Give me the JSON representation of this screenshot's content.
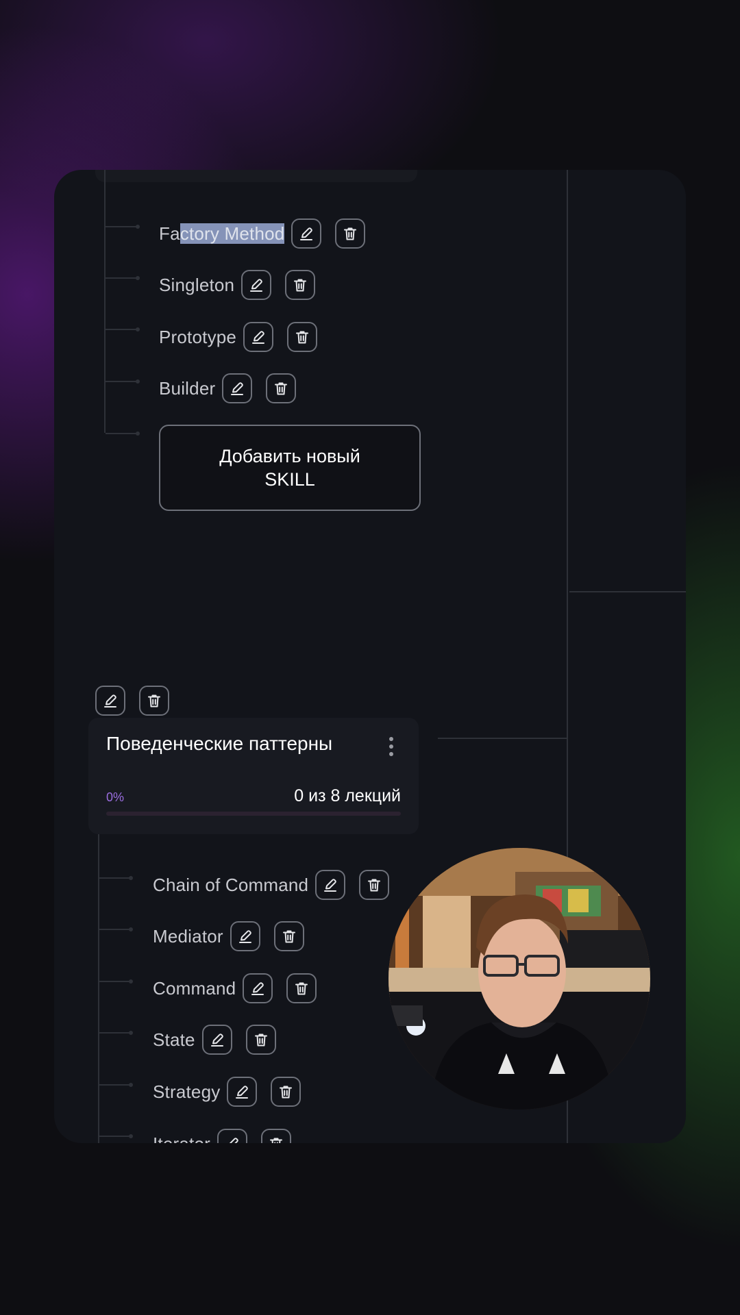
{
  "creational_skills": [
    {
      "label_before": "Fa",
      "label_selected": "ctory Method"
    },
    {
      "label": "Singleton"
    },
    {
      "label": "Prototype"
    },
    {
      "label": "Builder"
    }
  ],
  "add_skill_button": {
    "label": "Добавить новый SKILL"
  },
  "behavioral_group": {
    "title": "Поведенческие паттерны",
    "progress_label": "0%",
    "progress_value": 0,
    "lectures_count": "0 из 8 лекций"
  },
  "behavioral_skills": [
    {
      "label": "Chain of Command"
    },
    {
      "label": "Mediator"
    },
    {
      "label": "Command"
    },
    {
      "label": "State"
    },
    {
      "label": "Strategy"
    },
    {
      "label": "Iterator"
    }
  ],
  "icons": {
    "edit": "pencil-icon",
    "delete": "trash-icon",
    "menu": "more-vertical-icon"
  },
  "colors": {
    "accent": "#9b6ee0",
    "panel": "#12141a",
    "text": "#c9cad0",
    "selection": "#8593b8"
  }
}
